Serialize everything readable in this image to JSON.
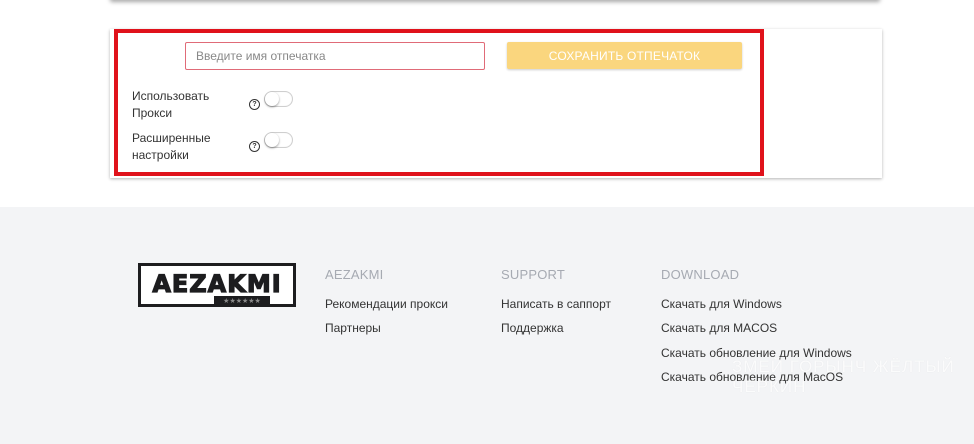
{
  "form": {
    "name_placeholder": "Введите имя отпечатка",
    "save_label": "СОХРАНИТЬ ОТПЕЧАТОК",
    "options": [
      {
        "label": "Использовать Прокси",
        "help": "?"
      },
      {
        "label": "Расширенные настройки",
        "help": "?"
      }
    ]
  },
  "footer": {
    "logo_text": "AEZAKMI",
    "columns": [
      {
        "title": "AEZAKMI",
        "links": [
          "Рекомендации прокси",
          "Партнеры"
        ]
      },
      {
        "title": "SUPPORT",
        "links": [
          "Написать в саппорт",
          "Поддержка"
        ]
      },
      {
        "title": "DOWNLOAD",
        "links": [
          "Скачать для Windows",
          "Скачать для MACOS",
          "Скачать обновление для Windows",
          "Скачать обновление для MacOS"
        ]
      }
    ],
    "watermark": "ЗМЕЙ ГОРЫНЧ ЖЁЛТЫЙ ЧЕРКИН"
  },
  "colors": {
    "highlight": "#e0121b",
    "save_button": "#fad67e",
    "footer_bg": "#f3f4f6",
    "column_title": "#a6aab2"
  }
}
